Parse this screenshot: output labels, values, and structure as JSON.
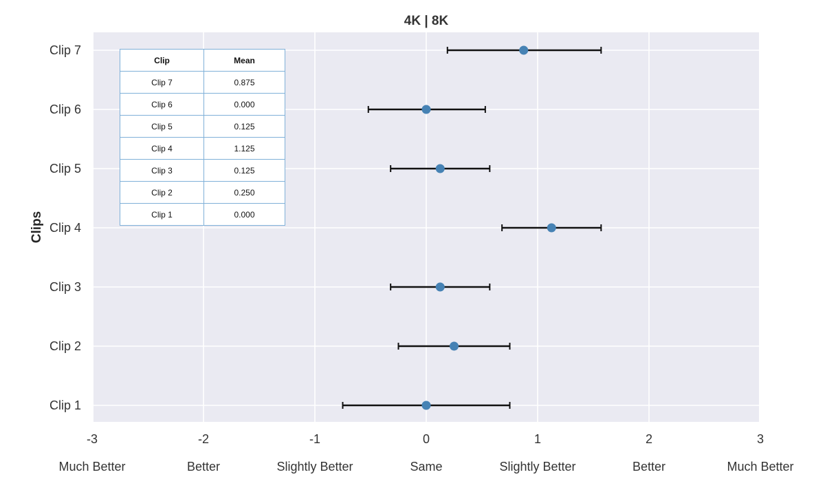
{
  "chart_data": {
    "type": "scatter",
    "subtype": "point-with-error-bars",
    "title": "4K | 8K",
    "xlabel": "",
    "ylabel": "Clips",
    "xlim": [
      -3,
      3
    ],
    "xticks": [
      -3,
      -2,
      -1,
      0,
      1,
      2,
      3
    ],
    "xtick_labels": [
      "-3",
      "-2",
      "-1",
      "0",
      "1",
      "2",
      "3"
    ],
    "xcategory_labels": [
      "Much Better",
      "Better",
      "Slightly Better",
      "Same",
      "Slightly Better",
      "Better",
      "Much Better"
    ],
    "categories": [
      "Clip 7",
      "Clip 6",
      "Clip 5",
      "Clip 4",
      "Clip 3",
      "Clip 2",
      "Clip 1"
    ],
    "series": [
      {
        "name": "Mean",
        "color": "#4682b4",
        "points": [
          {
            "clip": "Clip 7",
            "mean": 0.875,
            "low": 0.19,
            "high": 1.57
          },
          {
            "clip": "Clip 6",
            "mean": 0.0,
            "low": -0.52,
            "high": 0.53
          },
          {
            "clip": "Clip 5",
            "mean": 0.125,
            "low": -0.32,
            "high": 0.57
          },
          {
            "clip": "Clip 4",
            "mean": 1.125,
            "low": 0.68,
            "high": 1.57
          },
          {
            "clip": "Clip 3",
            "mean": 0.125,
            "low": -0.32,
            "high": 0.57
          },
          {
            "clip": "Clip 2",
            "mean": 0.25,
            "low": -0.25,
            "high": 0.75
          },
          {
            "clip": "Clip 1",
            "mean": 0.0,
            "low": -0.75,
            "high": 0.75
          }
        ]
      }
    ],
    "grid": true,
    "background_color": "#eaeaf2",
    "errorbar_color": "#111111",
    "inset_table": {
      "headers": [
        "Clip",
        "Mean"
      ],
      "rows": [
        [
          "Clip 7",
          "0.875"
        ],
        [
          "Clip 6",
          "0.000"
        ],
        [
          "Clip 5",
          "0.125"
        ],
        [
          "Clip 4",
          "1.125"
        ],
        [
          "Clip 3",
          "0.125"
        ],
        [
          "Clip 2",
          "0.250"
        ],
        [
          "Clip 1",
          "0.000"
        ]
      ],
      "placement": "top-left"
    }
  }
}
